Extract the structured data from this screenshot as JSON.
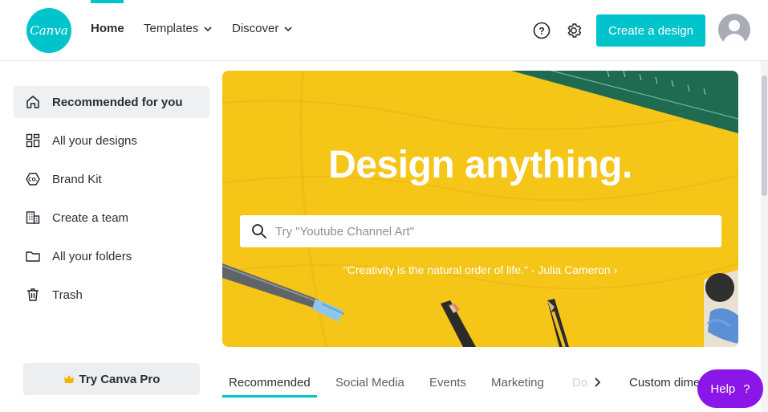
{
  "header": {
    "logo_text": "Canva",
    "nav": {
      "home": "Home",
      "templates": "Templates",
      "discover": "Discover"
    },
    "create_button": "Create a design"
  },
  "sidebar": {
    "items": [
      {
        "label": "Recommended for you",
        "icon": "home-icon"
      },
      {
        "label": "All your designs",
        "icon": "grid-icon"
      },
      {
        "label": "Brand Kit",
        "icon": "brand-kit-icon"
      },
      {
        "label": "Create a team",
        "icon": "building-icon"
      },
      {
        "label": "All your folders",
        "icon": "folder-icon"
      },
      {
        "label": "Trash",
        "icon": "trash-icon"
      }
    ],
    "pro_button": "Try Canva Pro"
  },
  "hero": {
    "title": "Design anything.",
    "search_placeholder": "Try \"Youtube Channel Art\"",
    "quote": "\"Creativity is the natural order of life.\" - Julia Cameron ›"
  },
  "tabs": {
    "items": [
      "Recommended",
      "Social Media",
      "Events",
      "Marketing",
      "Do"
    ],
    "custom": "Custom dime"
  },
  "help_fab": {
    "label": "Help",
    "icon": "?"
  },
  "colors": {
    "accent": "#00c4cc",
    "hero_bg": "#f5c518",
    "help_purple": "#8b16e8"
  }
}
